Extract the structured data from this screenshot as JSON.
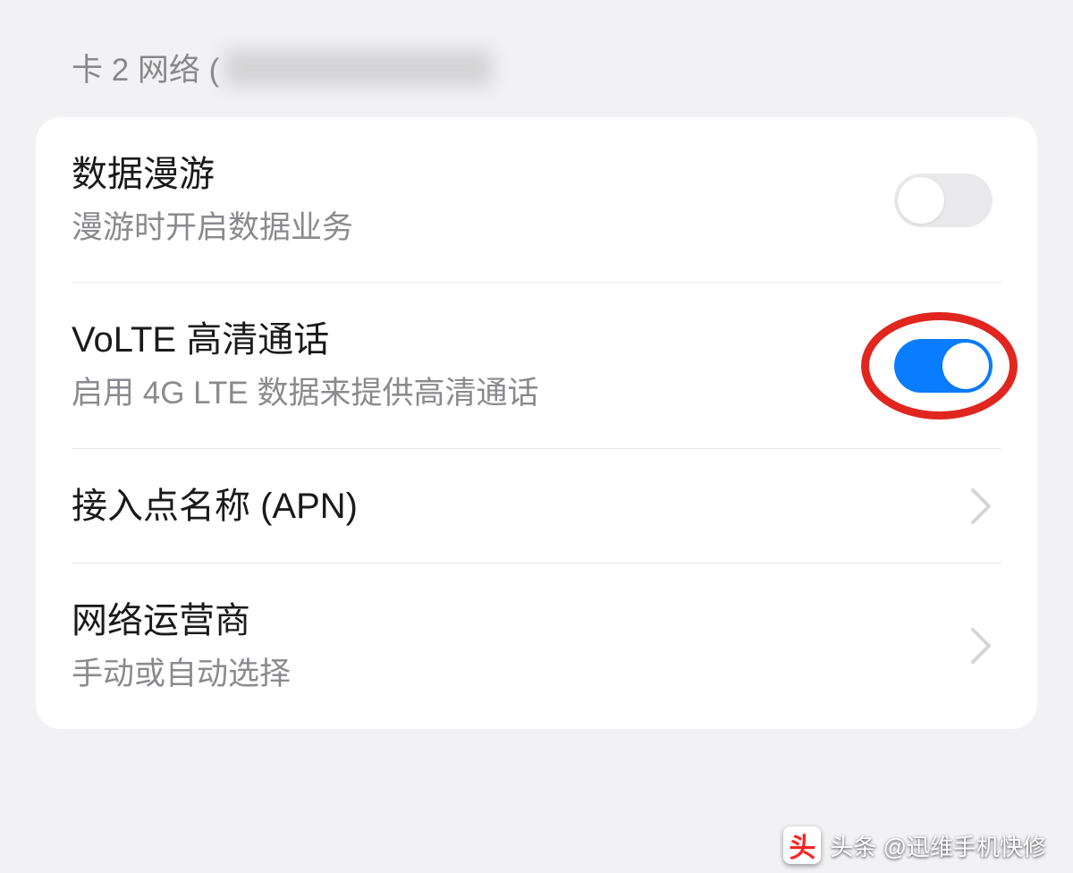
{
  "section": {
    "title": "卡 2 网络 ("
  },
  "rows": {
    "roaming": {
      "title": "数据漫游",
      "subtitle": "漫游时开启数据业务"
    },
    "volte": {
      "title": "VoLTE 高清通话",
      "subtitle": "启用 4G LTE 数据来提供高清通话"
    },
    "apn": {
      "title": "接入点名称 (APN)"
    },
    "carrier": {
      "title": "网络运营商",
      "subtitle": "手动或自动选择"
    }
  },
  "watermark": {
    "text": "头条 @迅维手机快修"
  }
}
